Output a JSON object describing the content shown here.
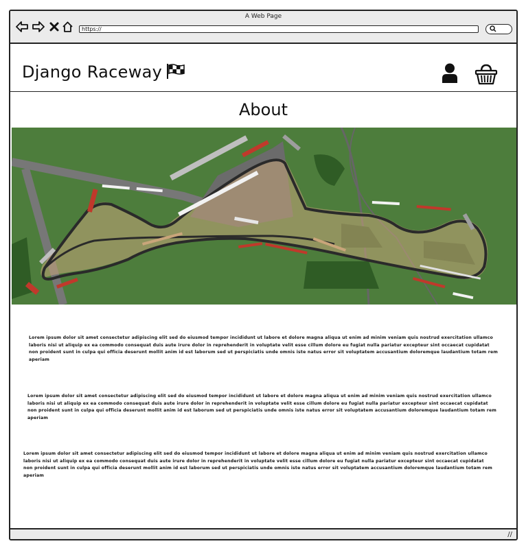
{
  "browser": {
    "window_title": "A Web Page",
    "url": "https://",
    "nav_icons": [
      "back-arrow-icon",
      "forward-arrow-icon",
      "close-x-icon",
      "home-icon"
    ],
    "search_icon": "search-icon"
  },
  "header": {
    "brand": "Django Raceway",
    "brand_icon": "checkered-flag-icon",
    "account_icon": "user-icon",
    "basket_icon": "basket-icon"
  },
  "main": {
    "heading": "About",
    "hero_image": "race-circuit-aerial-map",
    "paragraphs": [
      "Lorem ipsum dolor sit amet consectetur adipiscing elit sed do eiusmod tempor incididunt ut labore et dolore magna aliqua ut enim ad minim veniam quis nostrud exercitation ullamco laboris nisi ut aliquip ex ea commodo consequat duis aute irure dolor in reprehenderit in voluptate velit esse cillum dolore eu fugiat nulla pariatur excepteur sint occaecat cupidatat non proident sunt in culpa qui officia deserunt mollit anim id est laborum sed ut perspiciatis unde omnis iste natus error sit voluptatem accusantium doloremque laudantium totam rem aperiam",
      "Lorem ipsum dolor sit amet consectetur adipiscing elit sed do eiusmod tempor incididunt ut labore et dolore magna aliqua ut enim ad minim veniam quis nostrud exercitation ullamco laboris nisi ut aliquip ex ea commodo consequat duis aute irure dolor in reprehenderit in voluptate velit esse cillum dolore eu fugiat nulla pariatur excepteur sint occaecat cupidatat non proident sunt in culpa qui officia deserunt mollit anim id est laborum sed ut perspiciatis unde omnis iste natus error sit voluptatem accusantium doloremque laudantium totam rem aperiam",
      "Lorem ipsum dolor sit amet consectetur adipiscing elit sed do eiusmod tempor incididunt ut labore et dolore magna aliqua ut enim ad minim veniam quis nostrud exercitation ullamco laboris nisi ut aliquip ex ea commodo consequat duis aute irure dolor in reprehenderit in voluptate velit esse cillum dolore eu fugiat nulla pariatur excepteur sint occaecat cupidatat non proident sunt in culpa qui officia deserunt mollit anim id est laborum sed ut perspiciatis unde omnis iste natus error sit voluptatem accusantium doloremque laudantium totam rem aperiam"
    ]
  },
  "colors": {
    "grass": "#4a7a3a",
    "track": "#2c2c2c",
    "runoff": "#6b6b6b",
    "kerb_red": "#c0392b",
    "sand": "#c9a57a",
    "chrome_bg": "#ebebeb"
  }
}
